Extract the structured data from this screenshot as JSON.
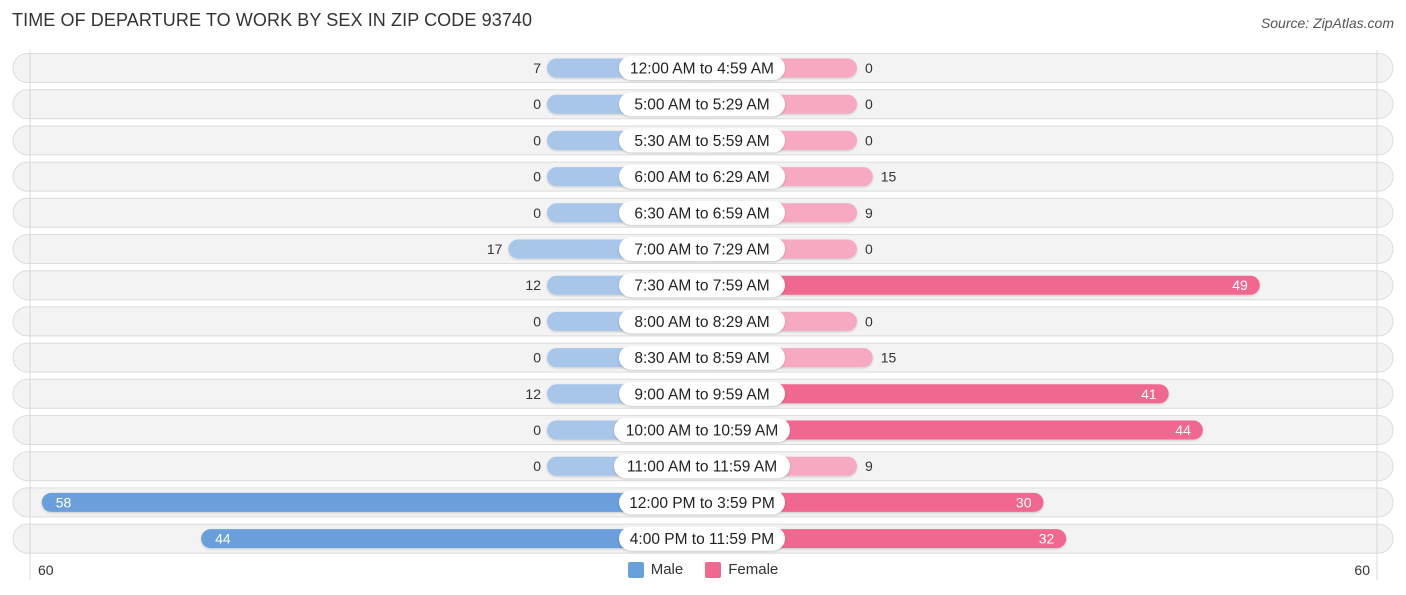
{
  "header": {
    "title": "TIME OF DEPARTURE TO WORK BY SEX IN ZIP CODE 93740",
    "source": "Source: ZipAtlas.com"
  },
  "legend": {
    "male_label": "Male",
    "female_label": "Female"
  },
  "colors": {
    "male_strong": "#6a9fdb",
    "male_light": "#a7c6ea",
    "female_strong": "#f06890",
    "female_light": "#f7a9c1",
    "row_bg": "#f3f3f3",
    "row_border": "#dcdcdc"
  },
  "axis": {
    "left_label": "60",
    "right_label": "60"
  },
  "chart_data": {
    "type": "bar",
    "orientation": "horizontal-diverging",
    "title": "TIME OF DEPARTURE TO WORK BY SEX IN ZIP CODE 93740",
    "xlabel": "",
    "ylabel": "",
    "xlim": [
      -60,
      60
    ],
    "legend_position": "bottom-center",
    "categories": [
      "12:00 AM to 4:59 AM",
      "5:00 AM to 5:29 AM",
      "5:30 AM to 5:59 AM",
      "6:00 AM to 6:29 AM",
      "6:30 AM to 6:59 AM",
      "7:00 AM to 7:29 AM",
      "7:30 AM to 7:59 AM",
      "8:00 AM to 8:29 AM",
      "8:30 AM to 8:59 AM",
      "9:00 AM to 9:59 AM",
      "10:00 AM to 10:59 AM",
      "11:00 AM to 11:59 AM",
      "12:00 PM to 3:59 PM",
      "4:00 PM to 11:59 PM"
    ],
    "series": [
      {
        "name": "Male",
        "values": [
          7,
          0,
          0,
          0,
          0,
          17,
          12,
          0,
          0,
          12,
          0,
          0,
          58,
          44
        ]
      },
      {
        "name": "Female",
        "values": [
          0,
          0,
          0,
          15,
          9,
          0,
          49,
          0,
          15,
          41,
          44,
          9,
          30,
          32
        ]
      }
    ]
  }
}
